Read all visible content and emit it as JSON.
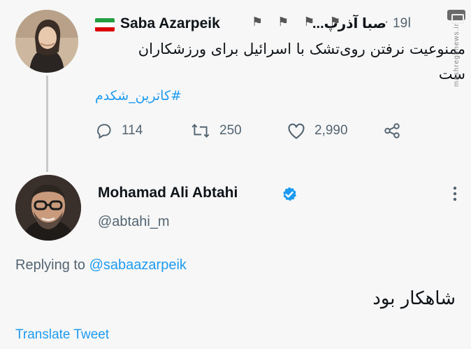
{
  "parent_tweet": {
    "display_name_en": "Saba Azarpeik",
    "display_name_fa": "صبا آذرپ...",
    "header_flags": "⚑ ⚑ ⚑ ⚑",
    "time": "19ا",
    "dot": "·",
    "body_line1": "ممنوعیت نرفتن روی‌تشک با اسرائیل برای ورزشکاران",
    "body_line2": "ست",
    "hashtag": "#کاترین_شکدم",
    "stats": {
      "replies": "114",
      "retweets": "250",
      "likes": "2,990"
    }
  },
  "reply_tweet": {
    "display_name": "Mohamad Ali Abtahi",
    "handle": "@abtahi_m",
    "replying_prefix": "Replying to ",
    "replying_to": "@sabaazarpeik",
    "body": "شاهکار بود",
    "translate_label": "Translate Tweet"
  },
  "watermark": {
    "text": "mashreghnews.ir"
  },
  "colors": {
    "link": "#1d9bf0",
    "muted": "#536471",
    "verified": "#1d9bf0"
  }
}
